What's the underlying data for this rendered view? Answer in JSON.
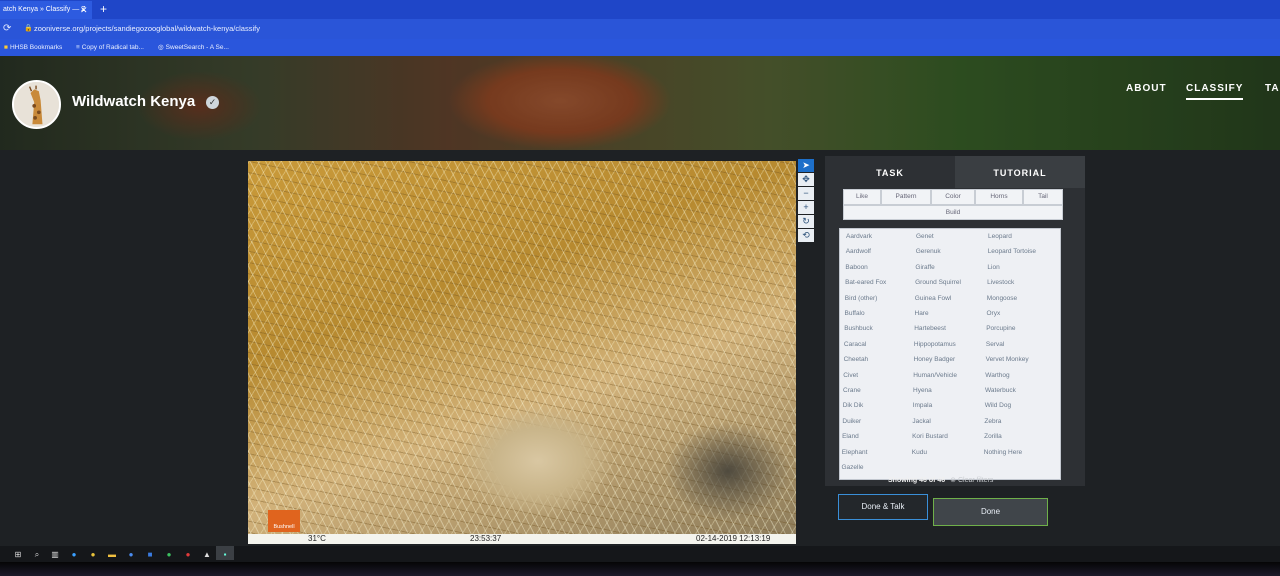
{
  "browser": {
    "tab_title": "atch Kenya » Classify — Z",
    "tab_close": "✕",
    "new_tab": "+",
    "url": "zooniverse.org/projects/sandiegozooglobal/wildwatch-kenya/classify",
    "bookmarks": [
      "HHSB Bookmarks",
      "Copy of Radical tab...",
      "SweetSearch - A Se..."
    ]
  },
  "header": {
    "project_title": "Wildwatch Kenya",
    "verified_icon": "✓",
    "nav": [
      "ABOUT",
      "CLASSIFY",
      "TA"
    ]
  },
  "subject": {
    "camera_brand": "Bushnell",
    "temperature": "31°C",
    "moon_timestamp": "23:53:37",
    "datetime": "02-14-2019 12:13:19"
  },
  "tools": [
    "pointer-icon",
    "pan-icon",
    "zoom-out-icon",
    "zoom-in-icon",
    "rotate-icon",
    "reset-icon"
  ],
  "panel": {
    "tabs": [
      "TASK",
      "TUTORIAL"
    ],
    "filters": [
      "Like",
      "Pattern",
      "Color",
      "Horns",
      "Tail"
    ],
    "build_filter": "Build",
    "species_col1": [
      "Aardvark",
      "Aardwolf",
      "Baboon",
      "Bat-eared Fox",
      "Bird (other)",
      "Buffalo",
      "Bushbuck",
      "Caracal",
      "Cheetah",
      "Civet",
      "Crane",
      "Dik Dik",
      "Duiker",
      "Eland",
      "Elephant",
      "Gazelle"
    ],
    "species_col2": [
      "Genet",
      "Gerenuk",
      "Giraffe",
      "Ground Squirrel",
      "Guinea Fowl",
      "Hare",
      "Hartebeest",
      "Hippopotamus",
      "Honey Badger",
      "Human/Vehicle",
      "Hyena",
      "Impala",
      "Jackal",
      "Kori Bustard",
      "Kudu"
    ],
    "species_col3": [
      "Leopard",
      "Leopard Tortoise",
      "Lion",
      "Livestock",
      "Mongoose",
      "Oryx",
      "Porcupine",
      "Serval",
      "Vervet Monkey",
      "Warthog",
      "Waterbuck",
      "Wild Dog",
      "Zebra",
      "Zorilla",
      "Nothing Here"
    ],
    "showing_text": "Showing 46 of 46",
    "clear_filters": "Clear filters",
    "done_talk_label": "Done & Talk",
    "done_label": "Done"
  },
  "colors": {
    "browser_blue": "#1f46c8",
    "accent_blue": "#3a8fd8",
    "done_green": "#6fb04a"
  }
}
